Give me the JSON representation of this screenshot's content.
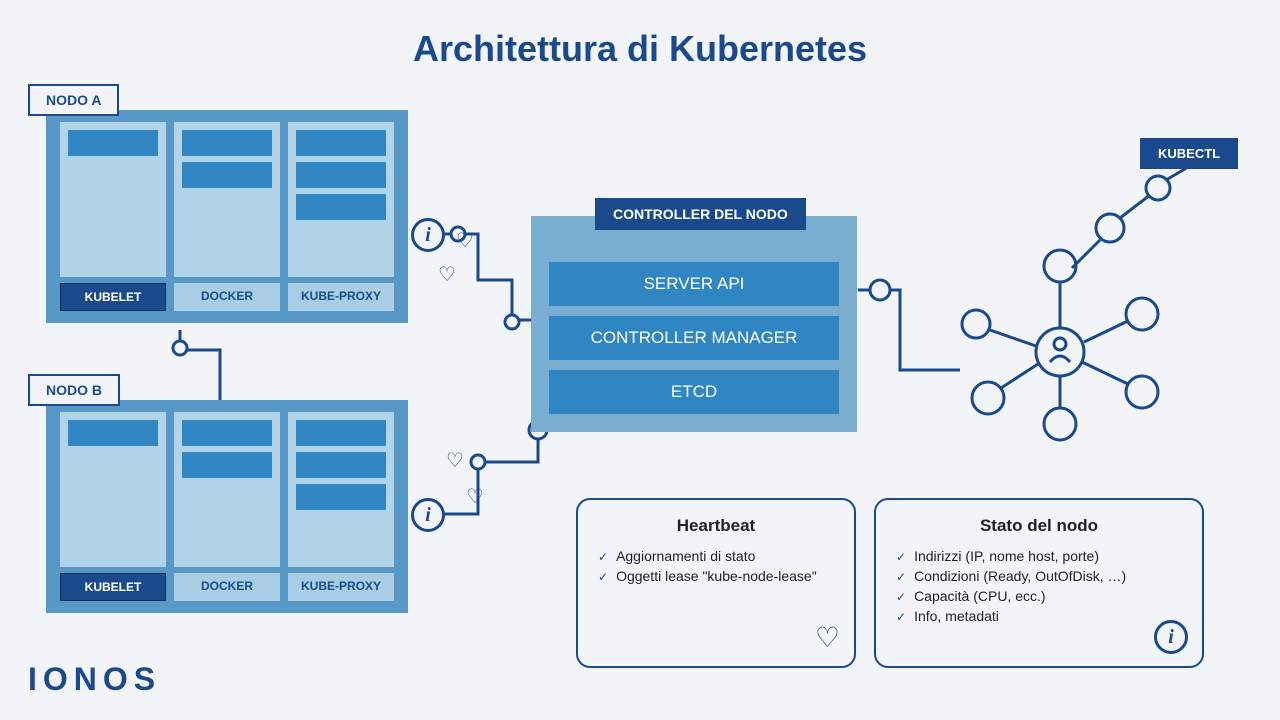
{
  "title": "Architettura di Kubernetes",
  "nodeA": {
    "label": "NODO A",
    "kubelet": "KUBELET",
    "docker": "DOCKER",
    "proxy": "KUBE-PROXY"
  },
  "nodeB": {
    "label": "NODO B",
    "kubelet": "KUBELET",
    "docker": "DOCKER",
    "proxy": "KUBE-PROXY"
  },
  "controller": {
    "label": "CONTROLLER DEL NODO",
    "api": "SERVER API",
    "mgr": "CONTROLLER MANAGER",
    "etcd": "ETCD"
  },
  "kubectl": "KUBECTL",
  "heartbeat": {
    "title": "Heartbeat",
    "items": [
      "Aggiornamenti di stato",
      "Oggetti lease \"kube-node-lease\""
    ]
  },
  "status": {
    "title": "Stato del nodo",
    "items": [
      "Indirizzi (IP, nome host, porte)",
      "Condizioni (Ready, OutOfDisk, …)",
      "Capacità (CPU, ecc.)",
      "Info, metadati"
    ]
  },
  "logo": "IONOS"
}
